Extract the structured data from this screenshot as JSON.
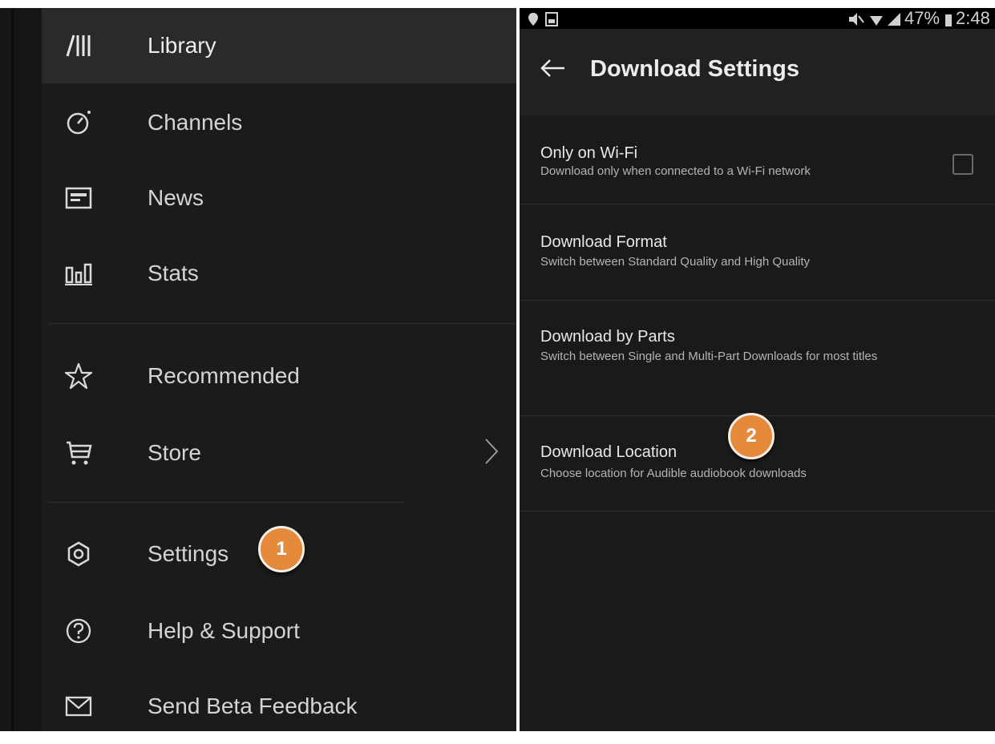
{
  "drawer": {
    "items": [
      {
        "label": "Library",
        "icon": "library-icon"
      },
      {
        "label": "Channels",
        "icon": "channels-icon"
      },
      {
        "label": "News",
        "icon": "news-icon"
      },
      {
        "label": "Stats",
        "icon": "stats-icon"
      },
      {
        "label": "Recommended",
        "icon": "star-icon"
      },
      {
        "label": "Store",
        "icon": "cart-icon"
      },
      {
        "label": "Settings",
        "icon": "gear-icon"
      },
      {
        "label": "Help & Support",
        "icon": "help-icon"
      },
      {
        "label": "Send Beta Feedback",
        "icon": "mail-icon"
      }
    ]
  },
  "callouts": {
    "first": "1",
    "second": "2"
  },
  "status_bar": {
    "battery": "47%",
    "time": "2:48 PM"
  },
  "screen": {
    "title": "Download Settings",
    "settings": [
      {
        "title": "Only on Wi-Fi",
        "subtitle": "Download only when connected to a Wi-Fi network",
        "checked": false
      },
      {
        "title": "Download Format",
        "subtitle": "Switch between Standard Quality and High Quality"
      },
      {
        "title": "Download by Parts",
        "subtitle": "Switch between Single and Multi-Part Downloads for most titles"
      },
      {
        "title": "Download Location",
        "subtitle": "Choose location for Audible audiobook downloads"
      }
    ]
  },
  "colors": {
    "accent_badge": "#e58a3a",
    "background": "#1b1b1b"
  }
}
